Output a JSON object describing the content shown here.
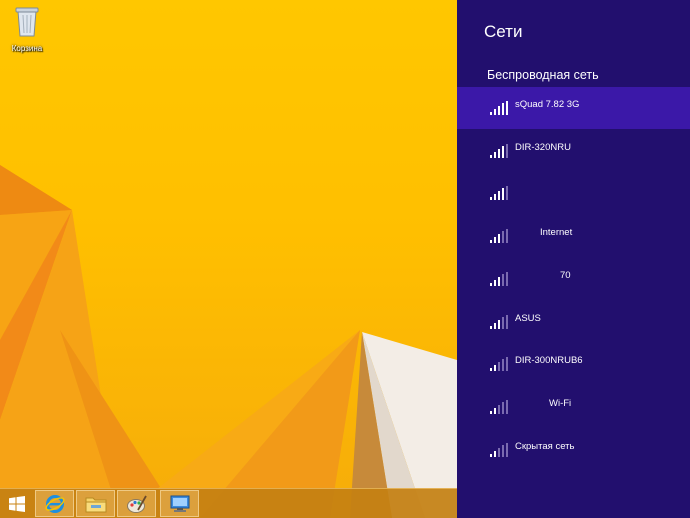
{
  "desktop": {
    "recycle_bin_label": "Корзина",
    "icon": "recycle-bin-icon"
  },
  "taskbar": {
    "items": [
      {
        "icon": "windows-start-icon"
      },
      {
        "icon": "internet-explorer-icon"
      },
      {
        "icon": "file-explorer-icon"
      },
      {
        "icon": "paint-icon"
      },
      {
        "icon": "remote-desktop-icon"
      }
    ]
  },
  "charm": {
    "title": "Сети",
    "section_title": "Беспроводная сеть",
    "accent_color": "#220f6e",
    "selected_color": "#3b18a8",
    "networks": [
      {
        "name": "sQuad 7.82 3G",
        "selected": true
      },
      {
        "name": "DIR-320NRU",
        "selected": false
      },
      {
        "name": "",
        "selected": false
      },
      {
        "name": "Internet",
        "selected": false
      },
      {
        "name": "70",
        "selected": false
      },
      {
        "name": "ASUS",
        "selected": false
      },
      {
        "name": "DIR-300NRUB6",
        "selected": false
      },
      {
        "name": "Wi-Fi",
        "selected": false
      },
      {
        "name": "Скрытая сеть",
        "selected": false
      }
    ]
  }
}
